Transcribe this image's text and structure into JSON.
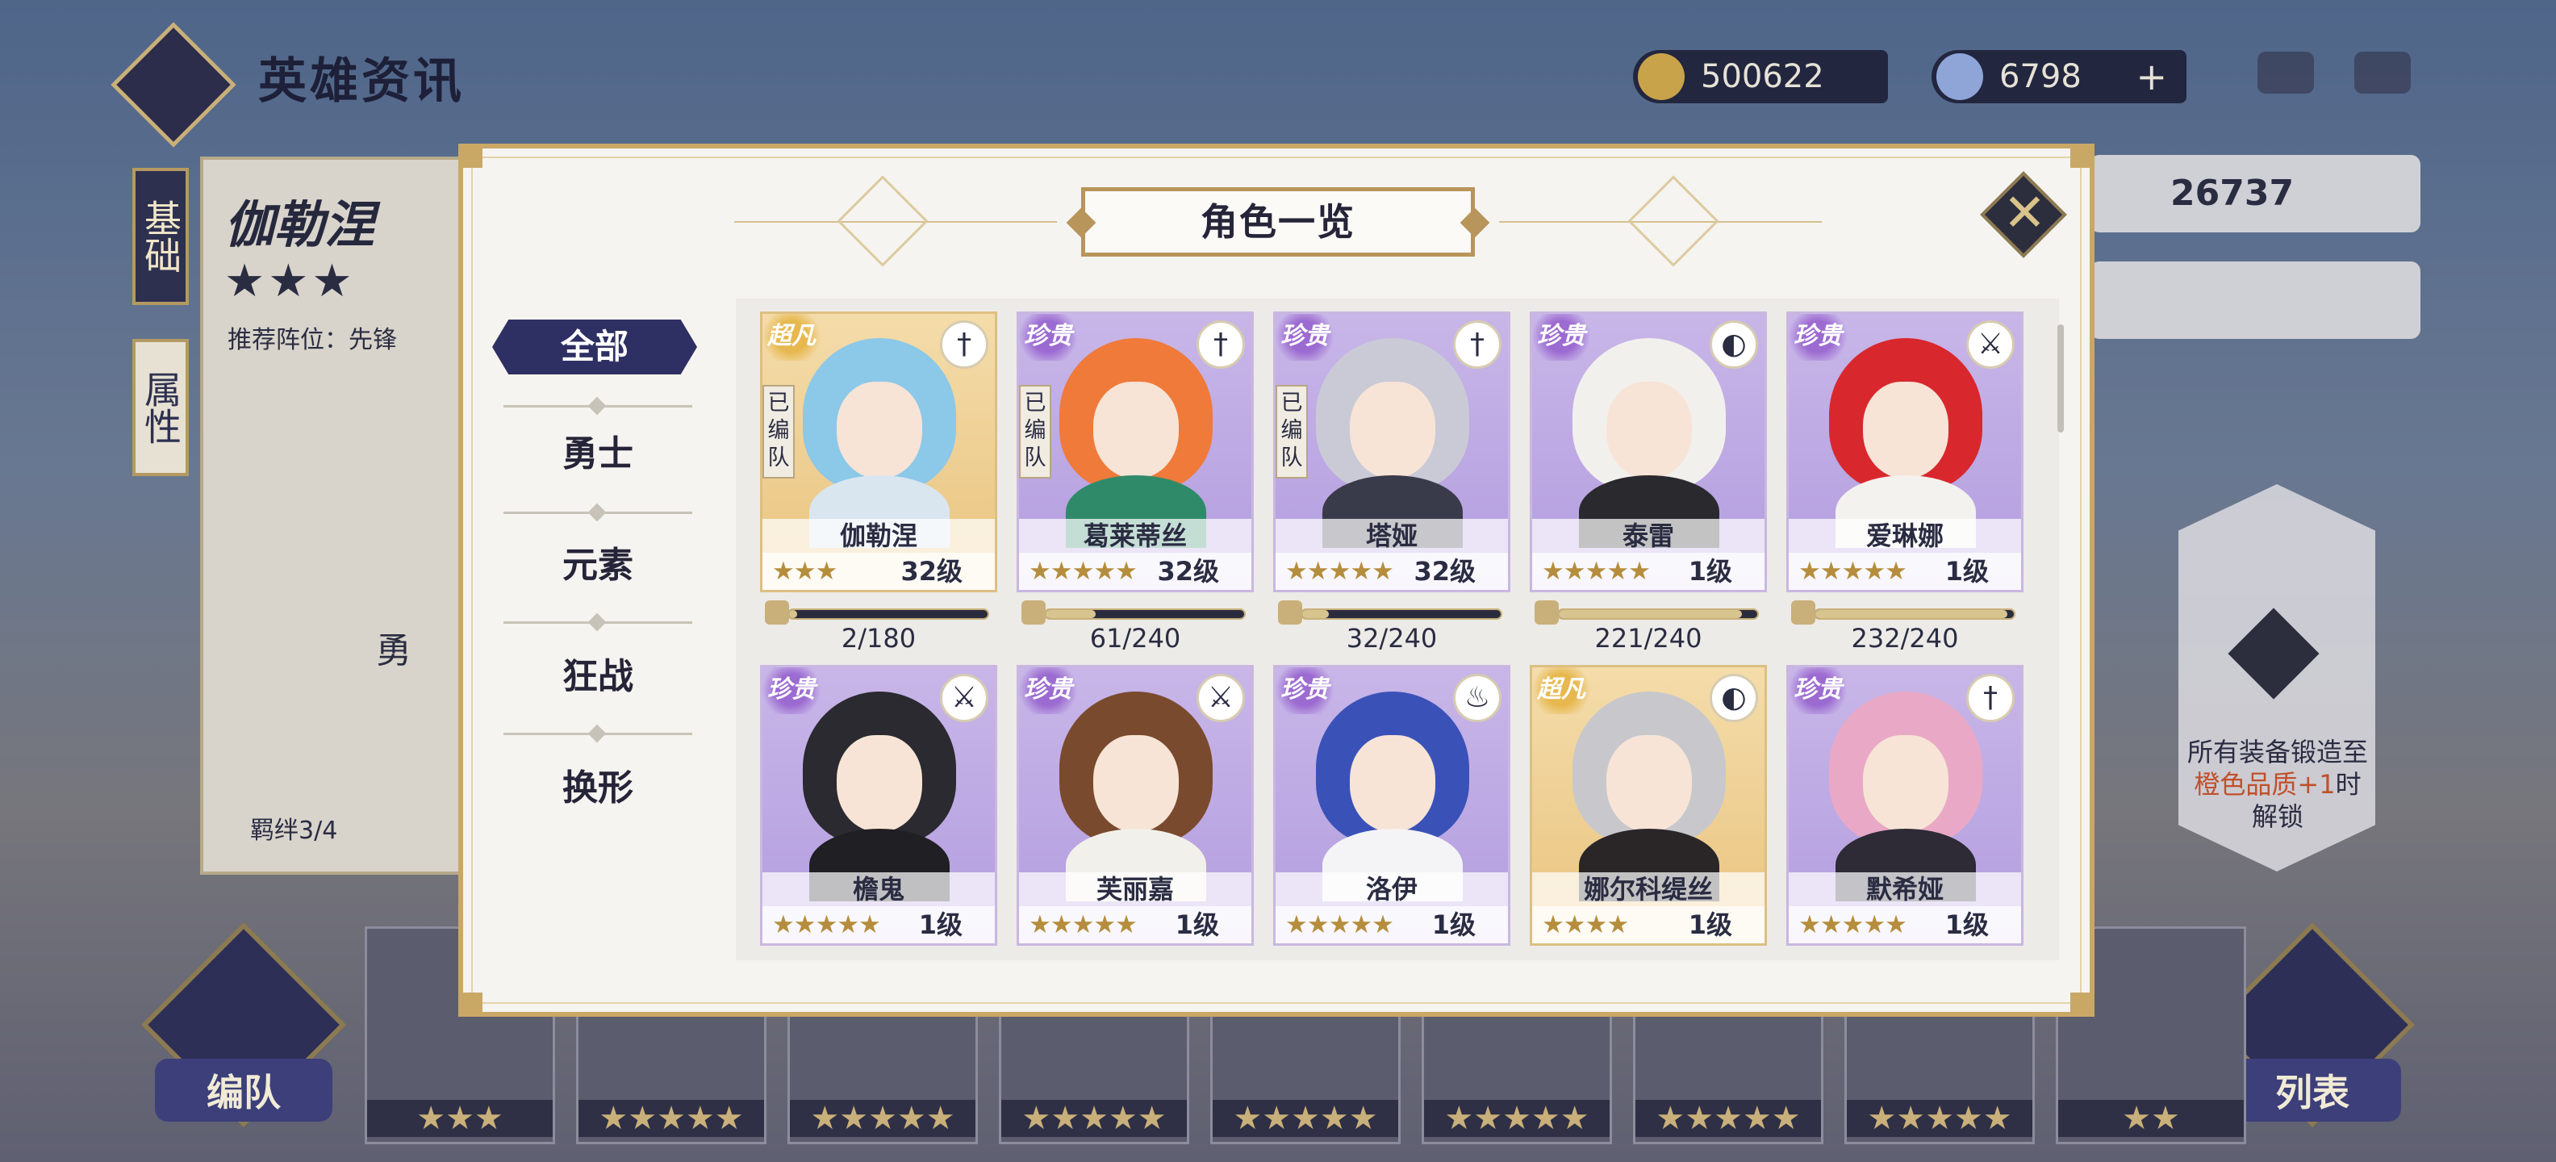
{
  "header": {
    "title": "英雄资讯",
    "gold": "500622",
    "gems": "6798",
    "gems_plus": "+"
  },
  "side_tabs": {
    "basic": "基础",
    "attr": "属性"
  },
  "hero": {
    "name": "伽勒涅",
    "stars": "★★★",
    "position": "推荐阵位：先锋",
    "bond": "羁绊3/4",
    "tag": "勇"
  },
  "right": {
    "power": "26737"
  },
  "lock": {
    "line1": "所有装备锻造至",
    "line2": "橙色品质+1",
    "line3": "时解锁"
  },
  "bottom": {
    "team": "编队",
    "list": "列表"
  },
  "modal": {
    "title": "角色一览",
    "close": "✕",
    "categories": {
      "all": "全部",
      "c1": "勇士",
      "c2": "元素",
      "c3": "狂战",
      "c4": "换形"
    },
    "heroes": [
      {
        "name": "伽勒涅",
        "rarity": "超凡",
        "class_icon": "sword-icon",
        "class_glyph": "†",
        "stars": "★★★",
        "level": "32级",
        "team": "已编队",
        "progress": "2/180",
        "progress_value": 0.011,
        "bg": "gold",
        "hair": "#8cc8e8",
        "body": "#d9e6f0"
      },
      {
        "name": "葛莱蒂丝",
        "rarity": "珍贵",
        "class_icon": "sword-icon",
        "class_glyph": "†",
        "stars": "★★★★★",
        "level": "32级",
        "team": "已编队",
        "progress": "61/240",
        "progress_value": 0.254,
        "bg": "purple",
        "hair": "#f07a3a",
        "body": "#2f8a6a"
      },
      {
        "name": "塔娅",
        "rarity": "珍贵",
        "class_icon": "sword-icon",
        "class_glyph": "†",
        "stars": "★★★★★",
        "level": "32级",
        "team": "已编队",
        "progress": "32/240",
        "progress_value": 0.133,
        "bg": "purple",
        "hair": "#c9cad6",
        "body": "#3a3b4a"
      },
      {
        "name": "泰雷",
        "rarity": "珍贵",
        "class_icon": "mask-icon",
        "class_glyph": "◐",
        "stars": "★★★★★",
        "level": "1级",
        "team": "",
        "progress": "221/240",
        "progress_value": 0.921,
        "bg": "purple",
        "hair": "#f2f0ec",
        "body": "#2a2a2e"
      },
      {
        "name": "爱琳娜",
        "rarity": "珍贵",
        "class_icon": "axe-icon",
        "class_glyph": "⚔",
        "stars": "★★★★★",
        "level": "1级",
        "team": "",
        "progress": "232/240",
        "progress_value": 0.967,
        "bg": "purple",
        "hair": "#d8282e",
        "body": "#f4f2ee"
      },
      {
        "name": "檐鬼",
        "rarity": "珍贵",
        "class_icon": "axe-icon",
        "class_glyph": "⚔",
        "stars": "★★★★★",
        "level": "1级",
        "team": "",
        "progress": "",
        "progress_value": 0,
        "bg": "purple",
        "hair": "#2a2a30",
        "body": "#1f1f24"
      },
      {
        "name": "芙丽嘉",
        "rarity": "珍贵",
        "class_icon": "axe-icon",
        "class_glyph": "⚔",
        "stars": "★★★★★",
        "level": "1级",
        "team": "",
        "progress": "",
        "progress_value": 0,
        "bg": "purple",
        "hair": "#7a4a2e",
        "body": "#f2f0ea"
      },
      {
        "name": "洛伊",
        "rarity": "珍贵",
        "class_icon": "flame-icon",
        "class_glyph": "♨",
        "stars": "★★★★★",
        "level": "1级",
        "team": "",
        "progress": "",
        "progress_value": 0,
        "bg": "purple",
        "hair": "#3a52b8",
        "body": "#f4f4f6"
      },
      {
        "name": "娜尔科缇丝",
        "rarity": "超凡",
        "class_icon": "mask-icon",
        "class_glyph": "◐",
        "stars": "★★★★",
        "level": "1级",
        "team": "",
        "progress": "",
        "progress_value": 0,
        "bg": "gold",
        "hair": "#c8c8cc",
        "body": "#2a2628"
      },
      {
        "name": "默希娅",
        "rarity": "珍贵",
        "class_icon": "sword-icon",
        "class_glyph": "†",
        "stars": "★★★★★",
        "level": "1级",
        "team": "",
        "progress": "",
        "progress_value": 0,
        "bg": "purple",
        "hair": "#e9a9c6",
        "body": "#2e2a36"
      }
    ]
  },
  "strip": [
    {
      "stars": "★★★"
    },
    {
      "stars": "★★★★★"
    },
    {
      "stars": "★★★★★"
    },
    {
      "stars": "★★★★★"
    },
    {
      "stars": "★★★★★"
    },
    {
      "stars": "★★★★★"
    },
    {
      "stars": "★★★★★"
    },
    {
      "stars": "★★★★★"
    },
    {
      "stars": "★★"
    }
  ]
}
